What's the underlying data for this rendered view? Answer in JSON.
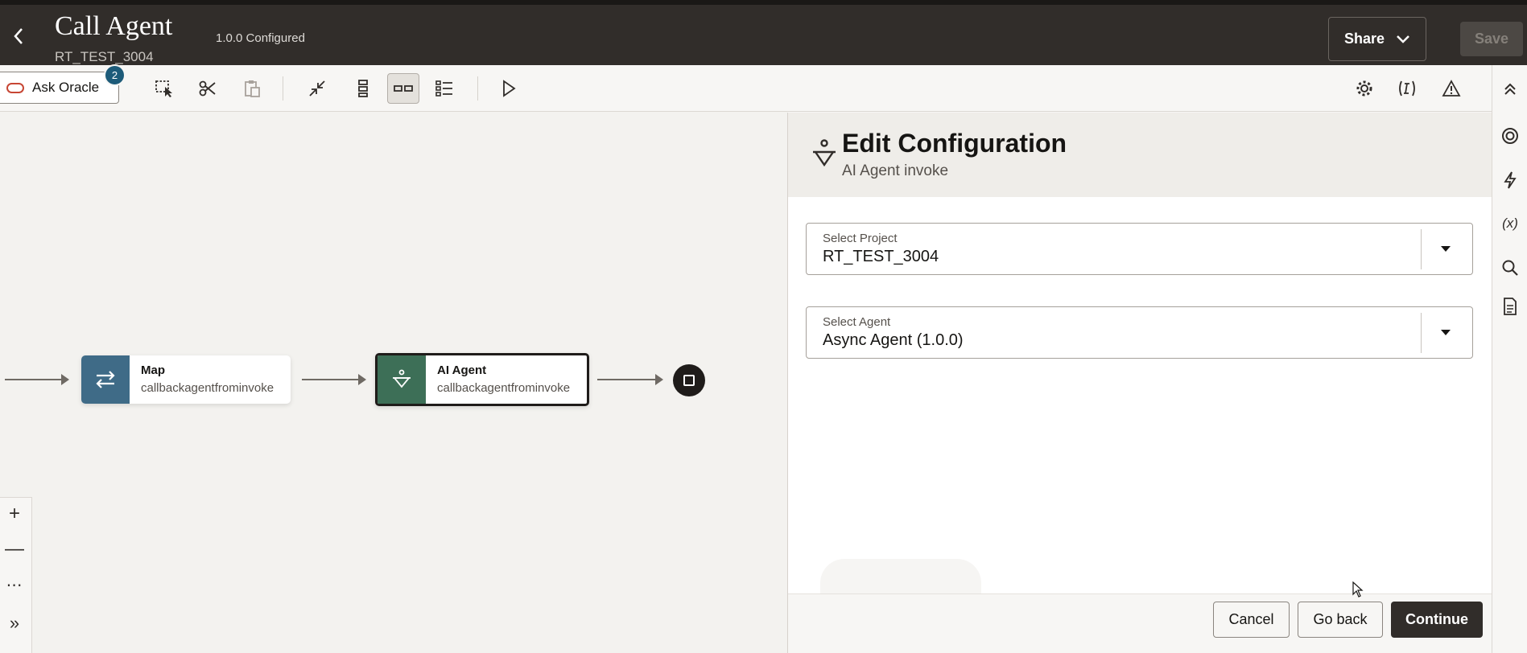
{
  "header": {
    "title": "Call Agent",
    "subtitle": "RT_TEST_3004",
    "version_status": "1.0.0 Configured",
    "share_label": "Share",
    "save_label": "Save"
  },
  "toolbar": {
    "ask_label": "Ask Oracle",
    "ask_badge": "2"
  },
  "canvas": {
    "nodes": [
      {
        "name": "Map",
        "subtitle": "callbackagentfrominvoke",
        "color": "#3f6b87"
      },
      {
        "name": "AI Agent",
        "subtitle": "callbackagentfrominvoke",
        "color": "#3d6f57"
      }
    ]
  },
  "panel": {
    "title": "Edit Configuration",
    "subtitle": "AI Agent invoke",
    "project_label": "Select Project",
    "project_value": "RT_TEST_3004",
    "agent_label": "Select Agent",
    "agent_value": "Async Agent (1.0.0)",
    "cancel_label": "Cancel",
    "go_back_label": "Go back",
    "continue_label": "Continue"
  },
  "rail": {
    "variables_label": "(x)"
  },
  "colors": {
    "header_bg": "#312d2a",
    "primary_button": "#312d2a",
    "badge": "#1d5b79",
    "ask_accent": "#c74634"
  }
}
